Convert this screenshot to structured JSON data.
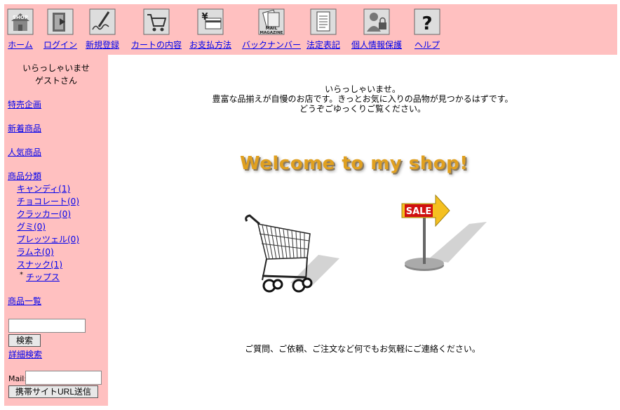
{
  "nav": [
    {
      "label": "ホーム",
      "icon": "shop-home-icon"
    },
    {
      "label": "ログイン",
      "icon": "door-login-icon"
    },
    {
      "label": "新規登録",
      "icon": "signature-pen-icon"
    },
    {
      "label": "カートの内容",
      "icon": "cart-icon"
    },
    {
      "label": "お支払方法",
      "icon": "yen-card-icon"
    },
    {
      "label": "バックナンバー",
      "icon": "mail-magazine-icon"
    },
    {
      "label": "法定表記",
      "icon": "document-icon"
    },
    {
      "label": "個人情報保護",
      "icon": "person-lock-icon"
    },
    {
      "label": "ヘルプ",
      "icon": "question-icon"
    }
  ],
  "icon_text": {
    "shop": "SHOP",
    "mail": "MAIL",
    "magazine": "MAGAZINE",
    "yen": "¥",
    "help": "?"
  },
  "sidebar": {
    "greeting_line1": "いらっしゃいませ",
    "greeting_line2": "ゲストさん",
    "special": "特売企画",
    "new_items": "新着商品",
    "popular": "人気商品",
    "categories_label": "商品分類",
    "categories": [
      "キャンディ(1)",
      "チョコレート(0)",
      "クラッカー(0)",
      "グミ(0)",
      "プレッツェル(0)",
      "ラムネ(0)",
      "スナック(1)"
    ],
    "subcategory_bullet": "*",
    "subcategory": "チップス",
    "product_list": "商品一覧",
    "search_button": "検索",
    "advanced_search": "詳細検索",
    "mail_label": "Mail:",
    "mobile_url_button": "携帯サイトURL送信"
  },
  "main": {
    "welcome_line1": "いらっしゃいませ。",
    "welcome_line2": "豊富な品揃えが自慢のお店です。きっとお気に入りの品物が見つかるはずです。",
    "welcome_line3": "どうぞごゆっくりご覧ください。",
    "banner": "Welcome to my shop!",
    "sale_sign": "SALE",
    "contact": "ご質問、ご依頼、ご注文など何でもお気軽にご連絡ください。"
  }
}
